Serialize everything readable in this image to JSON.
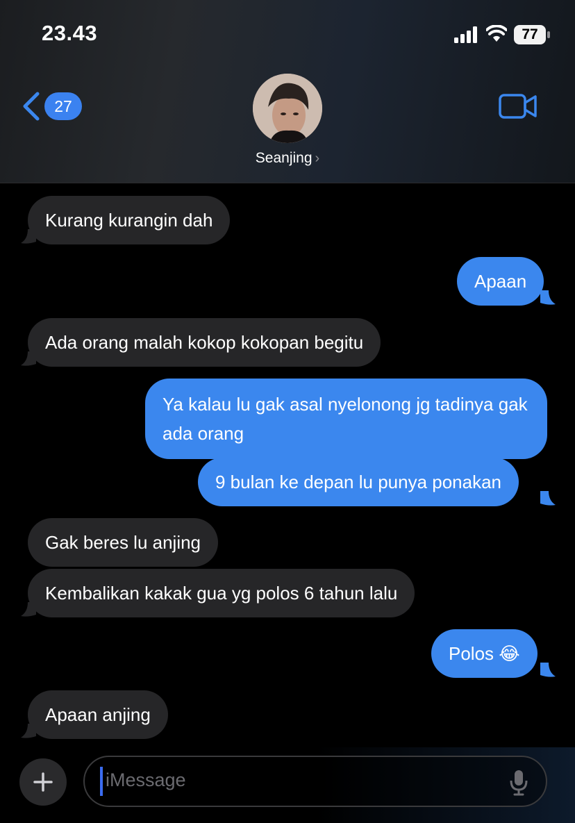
{
  "status_bar": {
    "time": "23.43",
    "battery": "77"
  },
  "header": {
    "back_count": "27",
    "contact_name": "Seanjing",
    "name_chevron": "›"
  },
  "messages": [
    {
      "dir": "in",
      "text": "Kurang kurangin dah"
    },
    {
      "dir": "out",
      "text": "Apaan"
    },
    {
      "dir": "in",
      "text": "Ada orang malah kokop kokopan begitu"
    },
    {
      "dir": "out",
      "text": "Ya kalau lu gak asal nyelonong jg tadinya gak ada orang"
    },
    {
      "dir": "out",
      "text": "9 bulan ke depan lu punya ponakan"
    },
    {
      "dir": "in",
      "text": "Gak beres lu anjing"
    },
    {
      "dir": "in",
      "text": "Kembalikan kakak gua yg polos 6 tahun lalu"
    },
    {
      "dir": "out",
      "text": "Polos 😂"
    },
    {
      "dir": "in",
      "text": "Apaan anjing"
    }
  ],
  "composer": {
    "placeholder": "iMessage"
  },
  "colors": {
    "accent": "#3b87ee",
    "incoming_bubble": "#262628",
    "background": "#000000"
  },
  "icons": [
    "signal-icon",
    "wifi-icon",
    "battery-icon",
    "back-chevron-icon",
    "facetime-video-icon",
    "plus-icon",
    "microphone-icon"
  ]
}
